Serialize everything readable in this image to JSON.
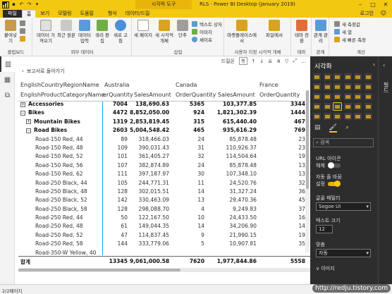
{
  "titlebar": {
    "context_tab": "시각적 도구",
    "title": "RLS - Power BI Desktop (January 2019)",
    "quick_access": [
      "save-icon",
      "undo-icon",
      "redo-icon"
    ]
  },
  "ribbon_tabs": {
    "file": "파일",
    "tabs": [
      "홈",
      "보기",
      "모델링",
      "도움말",
      "형식",
      "데이터/드릴"
    ],
    "active": "홈",
    "login": "로그인"
  },
  "ribbon": {
    "clipboard": {
      "paste": "붙여넣기",
      "group": "클립보드"
    },
    "external": {
      "get_data": "데이터 가져오기",
      "recent": "최근 원본",
      "enter_data": "데이터 입력",
      "edit_query": "쿼리 편집",
      "refresh": "새로 고침",
      "group": "외부 데이터"
    },
    "insert": {
      "new_page": "새 페이지",
      "new_visual": "새 시각적 개체",
      "qa": "단추",
      "textbox": "텍스트 상자",
      "image": "이미지",
      "shapes": "셰이프",
      "group": "삽입"
    },
    "custom_visuals": {
      "marketplace": "마켓플레이스에서",
      "from_file": "파일에서",
      "group": "사용자 지정 시각적 개체"
    },
    "themes": {
      "switch": "테마 전환",
      "group": "테마"
    },
    "relationships": {
      "manage": "관계 관리",
      "group": "관계"
    },
    "calculations": {
      "new_measure": "새 측정값",
      "new_column": "새 열",
      "quick_measure": "새 빠른 측정",
      "group": "계산"
    }
  },
  "canvas": {
    "back_button": "보고서로 돌아가기",
    "drill_label": "드릴온",
    "drill_select": "행"
  },
  "matrix": {
    "header_row1": [
      "EnglishCountryRegionName",
      "Australia",
      "Canada",
      "France"
    ],
    "header_row2": [
      "EnglishProductCategoryName",
      "erQuantity",
      "SalesAmount",
      "OrderQuantity",
      "SalesAmount",
      "OrderQuantity"
    ],
    "rows": [
      {
        "label": "Accessories",
        "level": 0,
        "expander": "+",
        "bold": true,
        "values": [
          "7004",
          "138,690.63",
          "5365",
          "103,377.85",
          "3344"
        ]
      },
      {
        "label": "Bikes",
        "level": 0,
        "expander": "−",
        "bold": true,
        "values": [
          "4472",
          "8,852,050.00",
          "924",
          "1,821,302.39",
          "1444"
        ]
      },
      {
        "label": "Mountain Bikes",
        "level": 1,
        "expander": "+",
        "bold": true,
        "values": [
          "1319",
          "2,853,819.45",
          "315",
          "615,440.40",
          "467"
        ]
      },
      {
        "label": "Road Bikes",
        "level": 1,
        "expander": "−",
        "bold": true,
        "values": [
          "2603",
          "5,004,548.42",
          "465",
          "935,616.29",
          "769"
        ]
      },
      {
        "label": "Road-150 Red, 44",
        "level": 2,
        "values": [
          "89",
          "318,466.03",
          "24",
          "85,878.48",
          "23"
        ]
      },
      {
        "label": "Road-150 Red, 48",
        "level": 2,
        "values": [
          "109",
          "390,031.43",
          "31",
          "110,926.37",
          "23"
        ]
      },
      {
        "label": "Road-150 Red, 52",
        "level": 2,
        "values": [
          "101",
          "361,405.27",
          "32",
          "114,504.64",
          "19"
        ]
      },
      {
        "label": "Road-150 Red, 56",
        "level": 2,
        "values": [
          "107",
          "382,874.89",
          "24",
          "85,878.48",
          "13"
        ]
      },
      {
        "label": "Road-150 Red, 62",
        "level": 2,
        "values": [
          "111",
          "397,187.97",
          "30",
          "107,348.10",
          "13"
        ]
      },
      {
        "label": "Road-250 Black, 44",
        "level": 2,
        "values": [
          "105",
          "244,771.31",
          "11",
          "24,520.76",
          "32"
        ]
      },
      {
        "label": "Road-250 Black, 48",
        "level": 2,
        "values": [
          "128",
          "302,015.51",
          "14",
          "31,327.24",
          "36"
        ]
      },
      {
        "label": "Road-250 Black, 52",
        "level": 2,
        "values": [
          "142",
          "330,463.09",
          "13",
          "29,470.36",
          "45"
        ]
      },
      {
        "label": "Road-250 Black, 58",
        "level": 2,
        "values": [
          "128",
          "298,088.70",
          "4",
          "9,249.83",
          "37"
        ]
      },
      {
        "label": "Road-250 Red, 44",
        "level": 2,
        "values": [
          "50",
          "122,167.50",
          "10",
          "24,433.50",
          "16"
        ]
      },
      {
        "label": "Road-250 Red, 48",
        "level": 2,
        "values": [
          "61",
          "149,044.35",
          "14",
          "34,206.90",
          "14"
        ]
      },
      {
        "label": "Road-250 Red, 52",
        "level": 2,
        "values": [
          "47",
          "114,837.45",
          "9",
          "21,990.15",
          "19"
        ]
      },
      {
        "label": "Road-250 Red, 58",
        "level": 2,
        "values": [
          "144",
          "333,779.06",
          "5",
          "10,907.81",
          "35"
        ]
      },
      {
        "label": "Road-350-W Yellow, 40",
        "level": 2,
        "values": [
          "",
          "",
          "",
          "",
          ""
        ]
      }
    ],
    "total": {
      "label": "합계",
      "values": [
        "13345",
        "9,061,000.58",
        "7620",
        "1,977,844.86",
        "5558"
      ]
    }
  },
  "viz_pane": {
    "title": "시각화",
    "search_placeholder": "검색",
    "url_action_label": "URL 아이콘",
    "url_toggle": "해제",
    "word_wrap_label": "자동 줄 바꿈",
    "word_wrap_toggle": "설정",
    "font_family_label": "글꼴 패밀리",
    "font_family": "Segoe UI",
    "text_size_label": "텍스트 크기",
    "text_size": "12",
    "alignment_label": "맞춤",
    "alignment": "자동",
    "more_label": "∨ 이미지"
  },
  "fields_pane": {
    "title": "필드"
  },
  "status": {
    "page": "2/2페이지"
  },
  "watermark": "http://redju.tistory.com",
  "colors": {
    "brand": "#f2c811",
    "pane_bg": "#2d2d2d",
    "accent_line": "#00b0e8"
  }
}
